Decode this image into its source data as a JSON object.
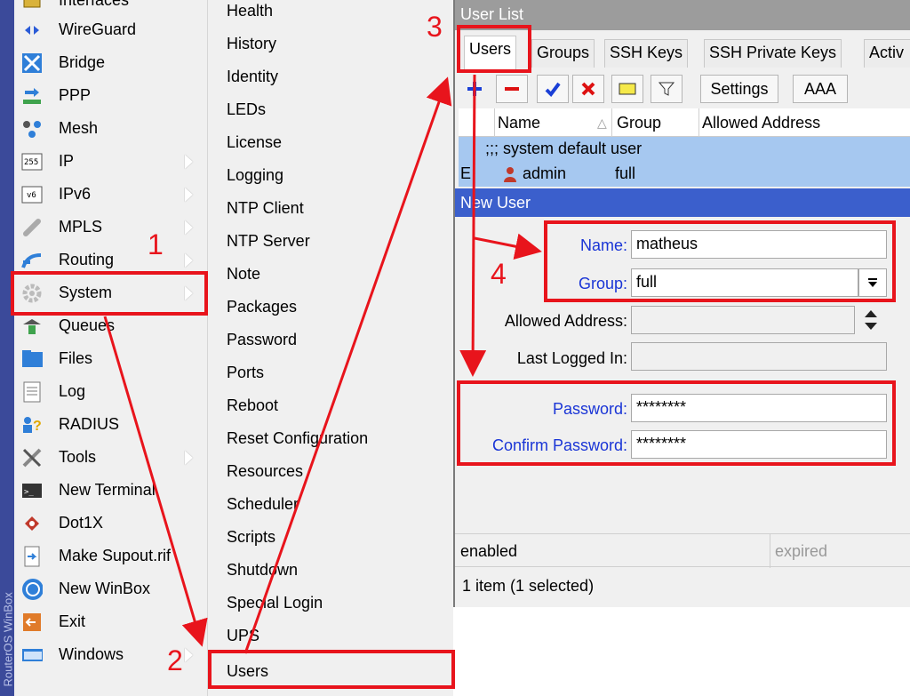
{
  "brand": "RouterOS WinBox",
  "left_menu": [
    {
      "label": "Interfaces",
      "icon": "interfaces-icon",
      "submenu": false
    },
    {
      "label": "WireGuard",
      "icon": "wireguard-icon",
      "submenu": false
    },
    {
      "label": "Bridge",
      "icon": "bridge-icon",
      "submenu": false
    },
    {
      "label": "PPP",
      "icon": "ppp-icon",
      "submenu": false
    },
    {
      "label": "Mesh",
      "icon": "mesh-icon",
      "submenu": false
    },
    {
      "label": "IP",
      "icon": "ip-icon",
      "submenu": true
    },
    {
      "label": "IPv6",
      "icon": "ipv6-icon",
      "submenu": true
    },
    {
      "label": "MPLS",
      "icon": "mpls-icon",
      "submenu": true
    },
    {
      "label": "Routing",
      "icon": "routing-icon",
      "submenu": true
    },
    {
      "label": "System",
      "icon": "gear-icon",
      "submenu": true
    },
    {
      "label": "Queues",
      "icon": "queues-icon",
      "submenu": false
    },
    {
      "label": "Files",
      "icon": "folder-icon",
      "submenu": false
    },
    {
      "label": "Log",
      "icon": "log-icon",
      "submenu": false
    },
    {
      "label": "RADIUS",
      "icon": "radius-icon",
      "submenu": false
    },
    {
      "label": "Tools",
      "icon": "tools-icon",
      "submenu": true
    },
    {
      "label": "New Terminal",
      "icon": "terminal-icon",
      "submenu": false
    },
    {
      "label": "Dot1X",
      "icon": "dot1x-icon",
      "submenu": false
    },
    {
      "label": "Make Supout.rif",
      "icon": "supout-icon",
      "submenu": false
    },
    {
      "label": "New WinBox",
      "icon": "winbox-icon",
      "submenu": false
    },
    {
      "label": "Exit",
      "icon": "exit-icon",
      "submenu": false
    },
    {
      "label": "Windows",
      "icon": "windows-icon",
      "submenu": true
    }
  ],
  "system_submenu": [
    "Health",
    "History",
    "Identity",
    "LEDs",
    "License",
    "Logging",
    "NTP Client",
    "NTP Server",
    "Note",
    "Packages",
    "Password",
    "Ports",
    "Reboot",
    "Reset Configuration",
    "Resources",
    "Scheduler",
    "Scripts",
    "Shutdown",
    "Special Login",
    "UPS",
    "Users"
  ],
  "user_list": {
    "title": "User List",
    "tabs": [
      "Users",
      "Groups",
      "SSH Keys",
      "SSH Private Keys",
      "Activ"
    ],
    "toolbar": {
      "settings": "Settings",
      "aaa": "AAA"
    },
    "columns": [
      "Name",
      "Group",
      "Allowed Address"
    ],
    "comment_row": ";;; system default user",
    "rows": [
      {
        "flag": "E",
        "name": "admin",
        "group": "full"
      }
    ]
  },
  "new_user": {
    "title": "New User",
    "name_label": "Name:",
    "name_value": "matheus",
    "group_label": "Group:",
    "group_value": "full",
    "allowed_label": "Allowed Address:",
    "allowed_value": "",
    "last_logged_label": "Last Logged In:",
    "last_logged_value": "",
    "password_label": "Password:",
    "password_value": "********",
    "confirm_label": "Confirm Password:",
    "confirm_value": "********"
  },
  "status": {
    "state": "enabled",
    "expired": "expired",
    "count": "1 item (1 selected)"
  },
  "steps": [
    "1",
    "2",
    "3",
    "4"
  ],
  "colors": {
    "highlight": "#e8141c",
    "selection": "#a6c8f0",
    "dialog_title": "#3b5fcc",
    "label_blue": "#1a35d6"
  }
}
